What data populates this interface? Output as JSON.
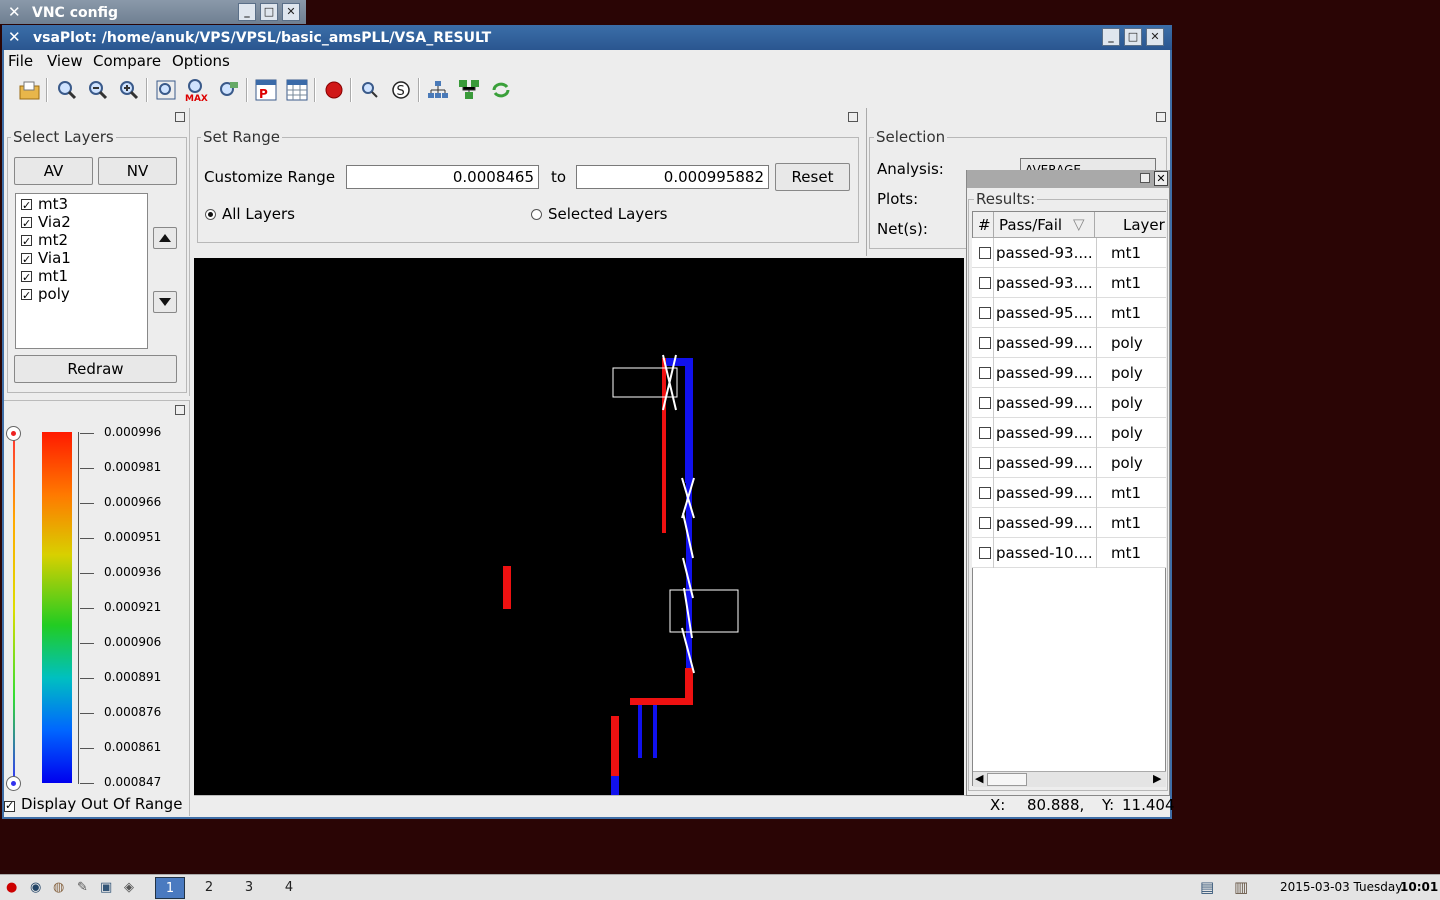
{
  "bg_window": {
    "title": "VNC config"
  },
  "window": {
    "title": "vsaPlot: /home/anuk/VPS/VPSL/basic_amsPLL/VSA_RESULT"
  },
  "menu": {
    "file": "File",
    "view": "View",
    "compare": "Compare",
    "options": "Options"
  },
  "toolbar": {
    "max_label": "MAX"
  },
  "select_layers": {
    "title": "Select Layers",
    "av": "AV",
    "nv": "NV",
    "redraw": "Redraw",
    "layers": [
      {
        "name": "mt3",
        "checked": true
      },
      {
        "name": "Via2",
        "checked": true
      },
      {
        "name": "mt2",
        "checked": true
      },
      {
        "name": "Via1",
        "checked": true
      },
      {
        "name": "mt1",
        "checked": true
      },
      {
        "name": "poly",
        "checked": true
      }
    ]
  },
  "set_range": {
    "title": "Set Range",
    "customize_label": "Customize Range",
    "from_value": "0.0008465",
    "to_label": "to",
    "to_value": "0.000995882",
    "reset": "Reset",
    "all_layers": "All Layers",
    "selected_layers": "Selected Layers"
  },
  "selection": {
    "title": "Selection",
    "analysis_label": "Analysis:",
    "analysis_value": "AVERAGE",
    "plots_label": "Plots:",
    "nets_label": "Net(s):"
  },
  "colorbar": {
    "ticks": [
      "0.000996",
      "0.000981",
      "0.000966",
      "0.000951",
      "0.000936",
      "0.000921",
      "0.000906",
      "0.000891",
      "0.000876",
      "0.000861",
      "0.000847"
    ],
    "display_out_of_range": "Display Out Of Range"
  },
  "results": {
    "title": "Results:",
    "col_num": "#",
    "col_passfail": "Pass/Fail",
    "col_layer": "Layer",
    "rows": [
      {
        "pf": "passed-93....",
        "layer": "mt1"
      },
      {
        "pf": "passed-93....",
        "layer": "mt1"
      },
      {
        "pf": "passed-95....",
        "layer": "mt1"
      },
      {
        "pf": "passed-99....",
        "layer": "poly"
      },
      {
        "pf": "passed-99....",
        "layer": "poly"
      },
      {
        "pf": "passed-99....",
        "layer": "poly"
      },
      {
        "pf": "passed-99....",
        "layer": "poly"
      },
      {
        "pf": "passed-99....",
        "layer": "poly"
      },
      {
        "pf": "passed-99....",
        "layer": "mt1"
      },
      {
        "pf": "passed-99....",
        "layer": "mt1"
      },
      {
        "pf": "passed-10....",
        "layer": "mt1"
      }
    ]
  },
  "status": {
    "x_label": "X:",
    "x_value": "80.888,",
    "y_label": "Y:",
    "y_value": "11.404"
  },
  "taskbar": {
    "ws1": "1",
    "ws2": "2",
    "ws3": "3",
    "ws4": "4",
    "date": "2015-03-03 Tuesday",
    "time": "10:01"
  },
  "colors": {
    "red": "#ee1111",
    "blue": "#1111ee",
    "titlebar": "#2f5f9c"
  }
}
